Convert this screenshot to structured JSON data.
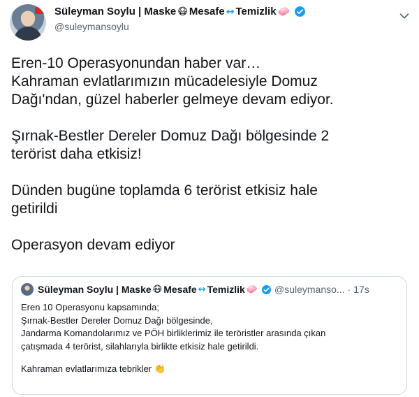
{
  "author": {
    "name_part1": "Süleyman Soylu | Maske",
    "emoji_mask": "😷",
    "name_part2": "Mesafe",
    "emoji_arrows": "↔",
    "name_part3": "Temizlik",
    "emoji_soap": "🧼",
    "handle": "@suleymansoylu"
  },
  "tweet": {
    "lines": [
      "Eren-10 Operasyonundan haber var…",
      "Kahraman evlatlarımızın mücadelesiyle Domuz",
      "Dağı'ndan, güzel haberler gelmeye devam ediyor.",
      "",
      "Şırnak-Bestler Dereler Domuz Dağı bölgesinde 2",
      "terörist daha etkisiz!",
      "",
      "Dünden bugüne toplamda 6 terörist etkisiz hale",
      "getirildi",
      "",
      "Operasyon devam ediyor"
    ]
  },
  "quoted": {
    "name_part1": "Süleyman Soylu | Maske",
    "emoji_mask": "😷",
    "name_part2": "Mesafe",
    "emoji_arrows": "↔",
    "name_part3": "Temizlik",
    "emoji_soap": "🧼",
    "handle": "@suleymanso...",
    "separator": "·",
    "time": "17s",
    "lines": [
      "Eren 10 Operasyonu kapsamında;",
      "Şırnak-Bestler Dereler Domuz Dağı bölgesinde,",
      "Jandarma Komandolarımız ve PÖH birliklerimiz ile teröristler arasında çıkan",
      "çatışmada 4 terörist, silahlarıyla birlikte etkisiz hale getirildi.",
      "",
      "Kahraman evlatlarımıza tebrikler 👏"
    ]
  },
  "icons": {
    "verified": "verified-badge-icon",
    "dropdown": "chevron-down-icon"
  },
  "colors": {
    "accent": "#1d9bf0",
    "secondary_text": "#536471",
    "border": "#cfd9de"
  }
}
